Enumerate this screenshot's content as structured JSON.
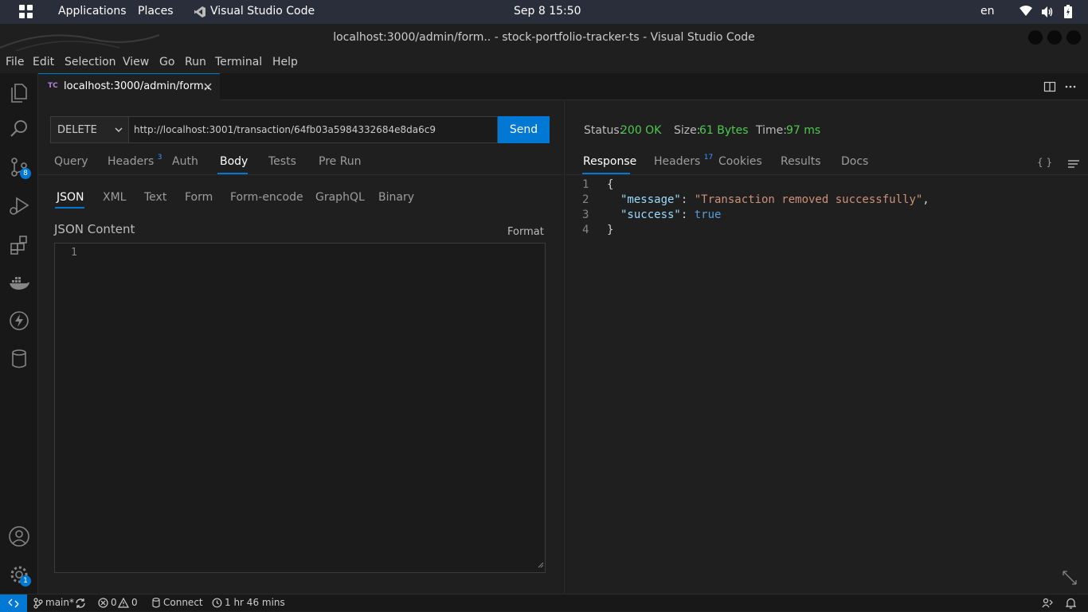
{
  "system_bar": {
    "applications": "Applications",
    "places": "Places",
    "active_app": "Visual Studio Code",
    "datetime": "Sep 8  15:50",
    "language": "en"
  },
  "window": {
    "title": "localhost:3000/admin/form.. - stock-portfolio-tracker-ts - Visual Studio Code"
  },
  "menu": [
    "File",
    "Edit",
    "Selection",
    "View",
    "Go",
    "Run",
    "Terminal",
    "Help"
  ],
  "activity_bar": {
    "source_control_badge": "8",
    "settings_badge": "1"
  },
  "editor_tab": {
    "icon_text": "TC",
    "label": "localhost:3000/admin/form.."
  },
  "request": {
    "method": "DELETE",
    "url": "http://localhost:3001/transaction/64fb03a5984332684e8da6c9",
    "send_label": "Send",
    "tabs": {
      "query": "Query",
      "headers": "Headers",
      "headers_count": "3",
      "auth": "Auth",
      "body": "Body",
      "tests": "Tests",
      "pre_run": "Pre Run"
    },
    "body_types": {
      "json": "JSON",
      "xml": "XML",
      "text": "Text",
      "form": "Form",
      "form_encode": "Form-encode",
      "graphql": "GraphQL",
      "binary": "Binary"
    },
    "json_content_label": "JSON Content",
    "format_label": "Format",
    "editor_line": "1"
  },
  "response": {
    "status_label": "Status:",
    "status_value": "200 OK",
    "size_label": "Size:",
    "size_value": "61 Bytes",
    "time_label": "Time:",
    "time_value": "97 ms",
    "tabs": {
      "response": "Response",
      "headers": "Headers",
      "headers_count": "17",
      "cookies": "Cookies",
      "results": "Results",
      "docs": "Docs",
      "braces": "{ }"
    },
    "line_numbers": [
      "1",
      "2",
      "3",
      "4"
    ],
    "body": {
      "open": "{",
      "key1": "\"message\"",
      "value1": "\"Transaction removed successfully\"",
      "key2": "\"success\"",
      "value2": "true",
      "close": "}"
    }
  },
  "statusbar": {
    "branch": "main*",
    "errors": "0",
    "warnings": "0",
    "connect": "Connect",
    "time_tracked": "1 hr 46 mins"
  }
}
